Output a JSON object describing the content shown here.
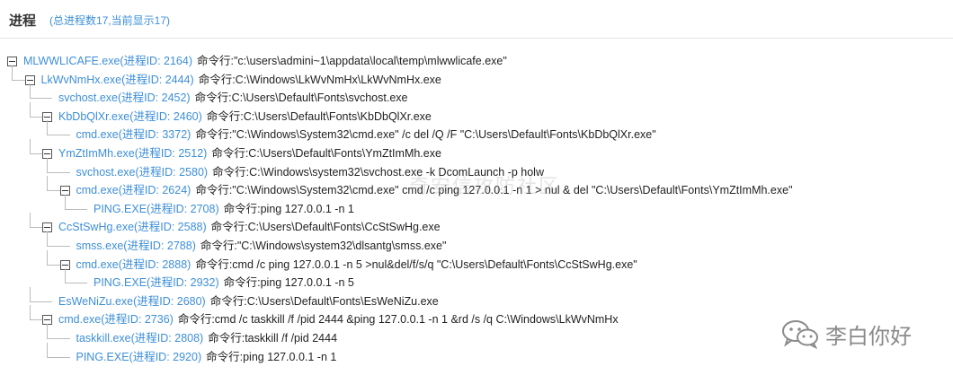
{
  "header": {
    "title": "进程",
    "subtitle": "(总进程数17,当前显示17)"
  },
  "processes": [
    {
      "level": 0,
      "expandable": true,
      "name": "MLWWLICAFE.exe(进程ID: 2164)",
      "cmd": "命令行:\"c:\\users\\admini~1\\appdata\\local\\temp\\mlwwlicafe.exe\""
    },
    {
      "level": 1,
      "expandable": true,
      "name": "LkWvNmHx.exe(进程ID: 2444)",
      "cmd": "命令行:C:\\Windows\\LkWvNmHx\\LkWvNmHx.exe"
    },
    {
      "level": 2,
      "expandable": false,
      "name": "svchost.exe(进程ID: 2452)",
      "cmd": "命令行:C:\\Users\\Default\\Fonts\\svchost.exe"
    },
    {
      "level": 2,
      "expandable": true,
      "name": "KbDbQlXr.exe(进程ID: 2460)",
      "cmd": "命令行:C:\\Users\\Default\\Fonts\\KbDbQlXr.exe"
    },
    {
      "level": 3,
      "expandable": false,
      "name": "cmd.exe(进程ID: 3372)",
      "cmd": "命令行:\"C:\\Windows\\System32\\cmd.exe\" /c del /Q /F \"C:\\Users\\Default\\Fonts\\KbDbQlXr.exe\""
    },
    {
      "level": 2,
      "expandable": true,
      "name": "YmZtImMh.exe(进程ID: 2512)",
      "cmd": "命令行:C:\\Users\\Default\\Fonts\\YmZtImMh.exe"
    },
    {
      "level": 3,
      "expandable": false,
      "name": "svchost.exe(进程ID: 2580)",
      "cmd": "命令行:C:\\Windows\\system32\\svchost.exe -k DcomLaunch -p holw"
    },
    {
      "level": 3,
      "expandable": true,
      "name": "cmd.exe(进程ID: 2624)",
      "cmd": "命令行:\"C:\\Windows\\System32\\cmd.exe\" cmd /c ping 127.0.0.1 -n 1 > nul & del \"C:\\Users\\Default\\Fonts\\YmZtImMh.exe\""
    },
    {
      "level": 4,
      "expandable": false,
      "name": "PING.EXE(进程ID: 2708)",
      "cmd": "命令行:ping 127.0.0.1 -n 1"
    },
    {
      "level": 2,
      "expandable": true,
      "name": "CcStSwHg.exe(进程ID: 2588)",
      "cmd": "命令行:C:\\Users\\Default\\Fonts\\CcStSwHg.exe"
    },
    {
      "level": 3,
      "expandable": false,
      "name": "smss.exe(进程ID: 2788)",
      "cmd": "命令行:\"C:\\Windows\\system32\\dlsantg\\smss.exe\""
    },
    {
      "level": 3,
      "expandable": true,
      "name": "cmd.exe(进程ID: 2888)",
      "cmd": "命令行:cmd /c ping 127.0.0.1 -n 5 >nul&del/f/s/q \"C:\\Users\\Default\\Fonts\\CcStSwHg.exe\""
    },
    {
      "level": 4,
      "expandable": false,
      "name": "PING.EXE(进程ID: 2932)",
      "cmd": "命令行:ping 127.0.0.1 -n 5"
    },
    {
      "level": 2,
      "expandable": false,
      "name": "EsWeNiZu.exe(进程ID: 2680)",
      "cmd": "命令行:C:\\Users\\Default\\Fonts\\EsWeNiZu.exe"
    },
    {
      "level": 2,
      "expandable": true,
      "name": "cmd.exe(进程ID: 2736)",
      "cmd": "命令行:cmd /c taskkill /f /pid 2444 &ping 127.0.0.1 -n 1 &rd /s /q C:\\Windows\\LkWvNmHx"
    },
    {
      "level": 3,
      "expandable": false,
      "name": "taskkill.exe(进程ID: 2808)",
      "cmd": "命令行:taskkill /f /pid 2444"
    },
    {
      "level": 3,
      "expandable": false,
      "name": "PING.EXE(进程ID: 2920)",
      "cmd": "命令行:ping 127.0.0.1 -n 1"
    }
  ],
  "watermarks": {
    "center": "奇安信攻防社区",
    "logo_text": "李白你好",
    "logo_icon": "wechat-icon"
  },
  "colors": {
    "link": "#3d8fd8",
    "text": "#222222",
    "line": "#bbbbbb"
  }
}
